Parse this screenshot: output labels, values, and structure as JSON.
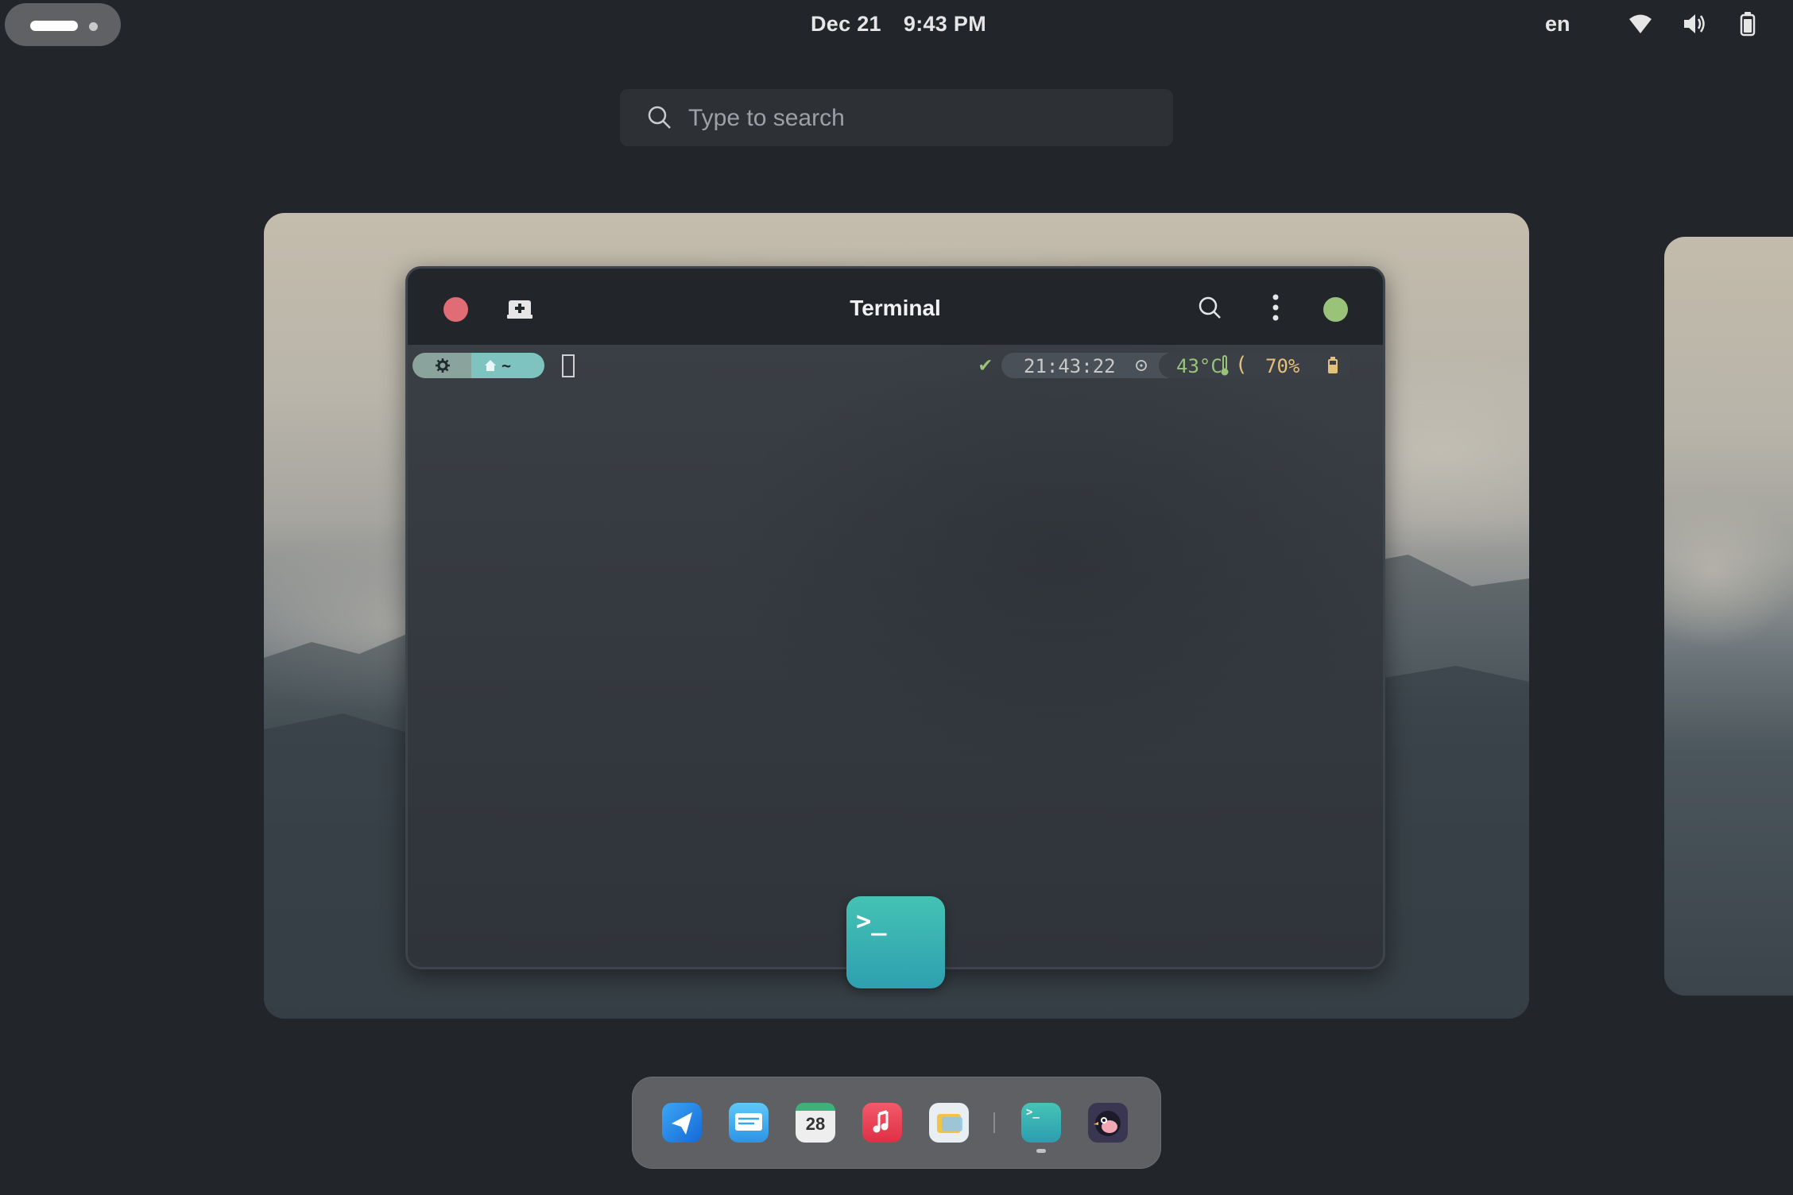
{
  "topbar": {
    "date": "Dec 21",
    "time": "9:43 PM",
    "language": "en",
    "icons": [
      "wifi-icon",
      "volume-icon",
      "battery-icon"
    ]
  },
  "search": {
    "placeholder": "Type to search"
  },
  "terminal": {
    "title": "Terminal",
    "prompt": {
      "home_label": "~"
    },
    "status": {
      "check": "✔",
      "time": "21:43:22",
      "temperature": "43°C",
      "battery": "70%"
    }
  },
  "dock": {
    "apps": [
      "Paper plane",
      "Mail",
      "Calendar",
      "Music",
      "Files",
      "Terminal",
      "Screenshot"
    ],
    "calendar_day": "28"
  },
  "colors": {
    "close": "#e06c75",
    "maximize": "#98c379",
    "accent_teal": "#7ec3c0"
  }
}
